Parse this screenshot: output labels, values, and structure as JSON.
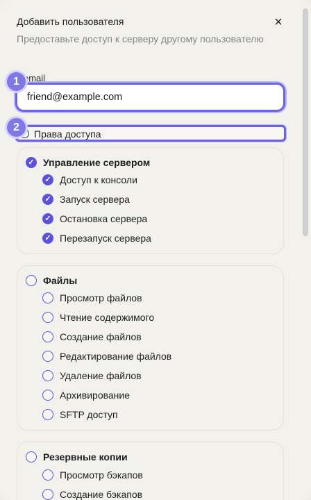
{
  "dialog": {
    "title": "Добавить пользователя",
    "subtitle": "Предоставьте доступ к серверу другому пользователю",
    "close_icon": "×"
  },
  "email": {
    "label": "email",
    "value": "friend@example.com"
  },
  "markers": [
    "1",
    "2"
  ],
  "permissions": {
    "toggle_label": "Права доступа",
    "groups": [
      {
        "title": "Управление сервером",
        "checked": true,
        "items": [
          {
            "label": "Доступ к консоли",
            "checked": true
          },
          {
            "label": "Запуск сервера",
            "checked": true
          },
          {
            "label": "Остановка сервера",
            "checked": true
          },
          {
            "label": "Перезапуск сервера",
            "checked": true
          }
        ]
      },
      {
        "title": "Файлы",
        "checked": false,
        "items": [
          {
            "label": "Просмотр файлов",
            "checked": false
          },
          {
            "label": "Чтение содержимого",
            "checked": false
          },
          {
            "label": "Создание файлов",
            "checked": false
          },
          {
            "label": "Редактирование файлов",
            "checked": false
          },
          {
            "label": "Удаление файлов",
            "checked": false
          },
          {
            "label": "Архивирование",
            "checked": false
          },
          {
            "label": "SFTP доступ",
            "checked": false
          }
        ]
      },
      {
        "title": "Резервные копии",
        "checked": false,
        "items": [
          {
            "label": "Просмотр бэкапов",
            "checked": false
          },
          {
            "label": "Создание бэкапов",
            "checked": false
          }
        ]
      }
    ]
  },
  "colors": {
    "accent": "#5a52dc",
    "focus_ring": "#6b63e6",
    "marker": "#7f79e6"
  }
}
